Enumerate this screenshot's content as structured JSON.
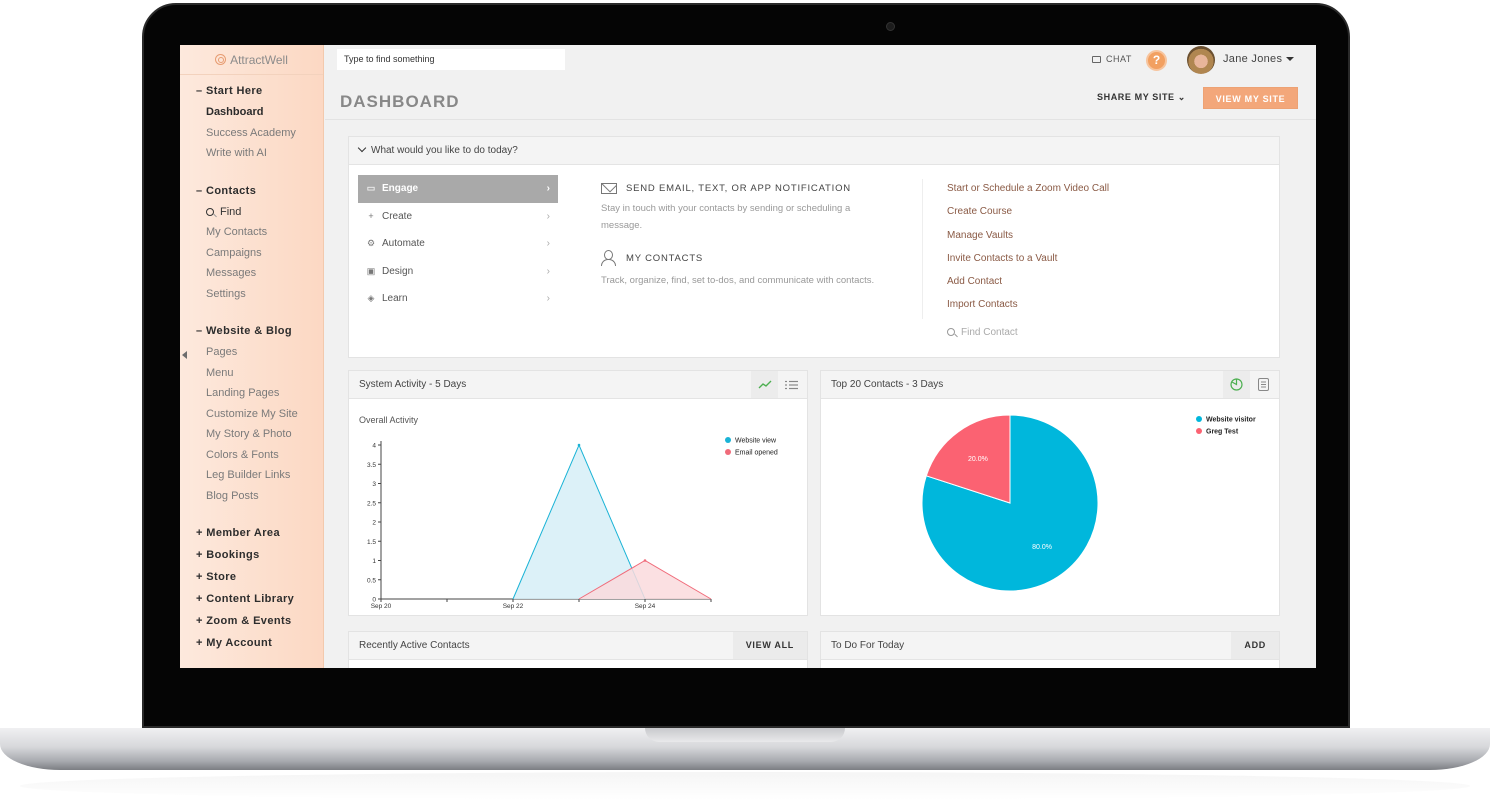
{
  "app": {
    "brand": "AttractWell"
  },
  "sidebar": {
    "sections": [
      {
        "label": "– Start Here",
        "items": [
          {
            "label": "Dashboard",
            "active": true
          },
          {
            "label": "Success Academy"
          },
          {
            "label": "Write with AI"
          }
        ]
      },
      {
        "label": "– Contacts",
        "items": [
          {
            "label": "Find",
            "icon": "search-icon"
          },
          {
            "label": "My Contacts"
          },
          {
            "label": "Campaigns"
          },
          {
            "label": "Messages"
          },
          {
            "label": "Settings"
          }
        ]
      },
      {
        "label": "– Website & Blog",
        "items": [
          {
            "label": "Pages"
          },
          {
            "label": "Menu"
          },
          {
            "label": "Landing Pages"
          },
          {
            "label": "Customize My Site"
          },
          {
            "label": "My Story & Photo"
          },
          {
            "label": "Colors & Fonts"
          },
          {
            "label": "Leg Builder Links"
          },
          {
            "label": "Blog Posts"
          }
        ]
      }
    ],
    "collapsed_sections": [
      "+ Member Area",
      "+ Bookings",
      "+ Store",
      "+ Content Library",
      "+ Zoom & Events",
      "+ My Account"
    ]
  },
  "header": {
    "search_placeholder": "Type to find something",
    "chat_label": "CHAT",
    "help_label": "?",
    "user_name": "Jane Jones",
    "page_title": "DASHBOARD",
    "share_label": "SHARE MY SITE ⌄",
    "view_site_label": "VIEW MY SITE"
  },
  "what_todo": {
    "title": "What would you like to do today?",
    "menu": [
      {
        "label": "Engage",
        "icon": "▭",
        "active": true
      },
      {
        "label": "Create",
        "icon": "+"
      },
      {
        "label": "Automate",
        "icon": "⚙"
      },
      {
        "label": "Design",
        "icon": "▣"
      },
      {
        "label": "Learn",
        "icon": "◈"
      }
    ],
    "sections": [
      {
        "title": "SEND EMAIL, TEXT, OR APP NOTIFICATION",
        "text": "Stay in touch with your contacts by sending or scheduling a message."
      },
      {
        "title": "MY CONTACTS",
        "text": "Track, organize, find, set to-dos, and communicate with contacts."
      }
    ],
    "links": [
      "Start or Schedule a Zoom Video Call",
      "Create Course",
      "Manage Vaults",
      "Invite Contacts to a Vault",
      "Add Contact",
      "Import Contacts"
    ],
    "find_contact_placeholder": "Find Contact"
  },
  "widgets": {
    "activity_title": "System Activity - 5 Days",
    "top20_title": "Top 20 Contacts - 3 Days",
    "recent_title": "Recently Active Contacts",
    "recent_action": "VIEW ALL",
    "todo_title": "To Do For Today",
    "todo_action": "ADD"
  },
  "chart_data": [
    {
      "type": "area",
      "title": "Overall Activity",
      "x": [
        "Sep 20",
        "Sep 21",
        "Sep 22",
        "Sep 23",
        "Sep 24",
        "Sep 25"
      ],
      "x_tick_labels": [
        "Sep 20",
        "",
        "Sep 22",
        "",
        "Sep 24",
        ""
      ],
      "ylim": [
        0,
        4
      ],
      "y_ticks": [
        0,
        0.5,
        1,
        1.5,
        2,
        2.5,
        3,
        3.5,
        4
      ],
      "series": [
        {
          "name": "Website view",
          "color": "#1ab3d6",
          "fill": "#d6eef7",
          "values": [
            0,
            0,
            0,
            4,
            0,
            0
          ]
        },
        {
          "name": "Email opened",
          "color": "#f06b7a",
          "fill": "#fadadd",
          "values": [
            0,
            0,
            0,
            0,
            1,
            0
          ]
        }
      ],
      "legend": "top-right"
    },
    {
      "type": "pie",
      "title": "Top 20 Contacts - 3 Days",
      "slices": [
        {
          "label": "Website visitor",
          "value": 80.0,
          "color": "#00b7dc"
        },
        {
          "label": "Greg Test",
          "value": 20.0,
          "color": "#fb6272"
        }
      ],
      "legend": "top-right"
    }
  ]
}
